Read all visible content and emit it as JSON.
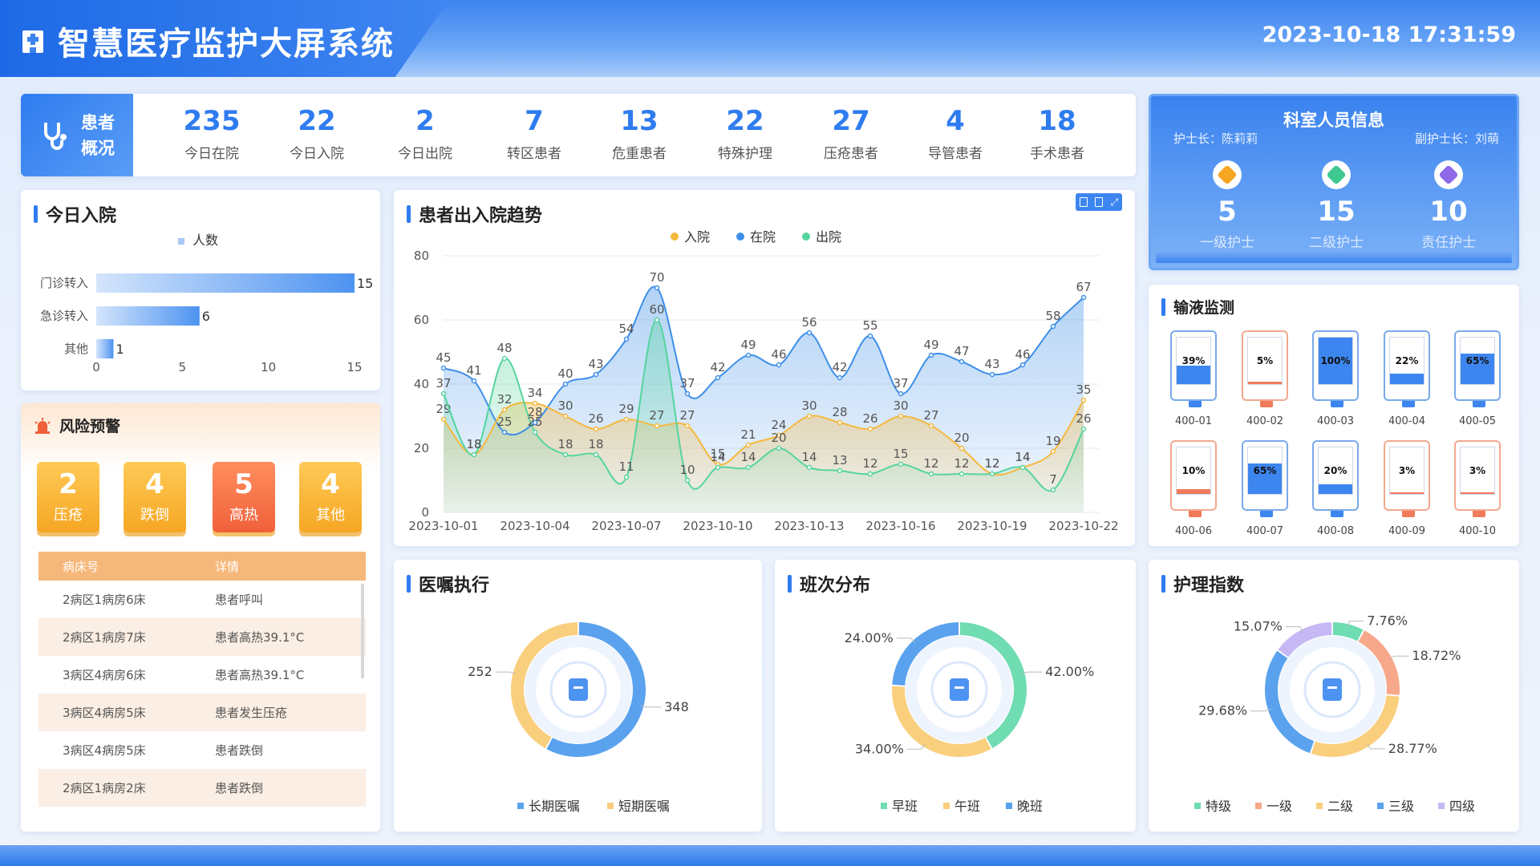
{
  "header": {
    "title": "智慧医疗监护大屏系统",
    "datetime": "2023-10-18 17:31:59"
  },
  "overview": {
    "label_line1": "患者",
    "label_line2": "概况",
    "stats": [
      {
        "value": "235",
        "label": "今日在院"
      },
      {
        "value": "22",
        "label": "今日入院"
      },
      {
        "value": "2",
        "label": "今日出院"
      },
      {
        "value": "7",
        "label": "转区患者"
      },
      {
        "value": "13",
        "label": "危重患者"
      },
      {
        "value": "22",
        "label": "特殊护理"
      },
      {
        "value": "27",
        "label": "压疮患者"
      },
      {
        "value": "4",
        "label": "导管患者"
      },
      {
        "value": "18",
        "label": "手术患者"
      }
    ]
  },
  "staff": {
    "title": "科室人员信息",
    "head_nurse": "护士长：陈莉莉",
    "deputy_head_nurse": "副护士长：刘萌",
    "items": [
      {
        "value": "5",
        "label": "一级护士",
        "color": "#f5a623"
      },
      {
        "value": "15",
        "label": "二级护士",
        "color": "#3ec88f"
      },
      {
        "value": "10",
        "label": "责任护士",
        "color": "#8e6ae8"
      }
    ]
  },
  "admission": {
    "title": "今日入院",
    "legend": "人数",
    "chart_data": {
      "type": "bar",
      "orientation": "horizontal",
      "categories": [
        "门诊转入",
        "急诊转入",
        "其他"
      ],
      "values": [
        15,
        6,
        1
      ],
      "xlim": [
        0,
        15
      ],
      "xticks": [
        "0",
        "5",
        "10",
        "15"
      ],
      "legend": "人数"
    }
  },
  "risk": {
    "title": "风险预警",
    "badges": [
      {
        "value": "2",
        "label": "压疮",
        "color": "#f5a623"
      },
      {
        "value": "4",
        "label": "跌倒",
        "color": "#f5a623"
      },
      {
        "value": "5",
        "label": "高热",
        "color": "#f0603a"
      },
      {
        "value": "4",
        "label": "其他",
        "color": "#f5a623"
      }
    ],
    "columns": [
      "病床号",
      "详情"
    ],
    "rows": [
      [
        "2病区1病房6床",
        "患者呼叫"
      ],
      [
        "2病区1病房7床",
        "患者高热39.1°C"
      ],
      [
        "3病区4病房6床",
        "患者高热39.1°C"
      ],
      [
        "3病区4病房5床",
        "患者发生压疮"
      ],
      [
        "3病区4病房5床",
        "患者跌倒"
      ],
      [
        "2病区1病房2床",
        "患者跌倒"
      ]
    ]
  },
  "trend": {
    "title": "患者出入院趋势",
    "chart_data": {
      "type": "line",
      "x": [
        "2023-10-01",
        "2023-10-02",
        "2023-10-03",
        "2023-10-04",
        "2023-10-05",
        "2023-10-06",
        "2023-10-07",
        "2023-10-08",
        "2023-10-09",
        "2023-10-10",
        "2023-10-11",
        "2023-10-12",
        "2023-10-13",
        "2023-10-14",
        "2023-10-15",
        "2023-10-16",
        "2023-10-17",
        "2023-10-18",
        "2023-10-19",
        "2023-10-20",
        "2023-10-21",
        "2023-10-22"
      ],
      "xticks": [
        "2023-10-01",
        "2023-10-04",
        "2023-10-07",
        "2023-10-10",
        "2023-10-13",
        "2023-10-16",
        "2023-10-19",
        "2023-10-22"
      ],
      "ylim": [
        0,
        80
      ],
      "yticks": [
        "0",
        "20",
        "40",
        "60",
        "80"
      ],
      "series": [
        {
          "name": "入院",
          "color": "#f5b83d",
          "values": [
            29,
            18,
            32,
            34,
            30,
            26,
            29,
            27,
            27,
            15,
            21,
            24,
            30,
            28,
            26,
            30,
            27,
            20,
            12,
            14,
            19,
            35
          ]
        },
        {
          "name": "在院",
          "color": "#3e8fe8",
          "values": [
            45,
            41,
            25,
            28,
            40,
            43,
            54,
            70,
            37,
            42,
            49,
            46,
            56,
            42,
            55,
            37,
            49,
            47,
            43,
            46,
            58,
            67
          ]
        },
        {
          "name": "出院",
          "color": "#56d49e",
          "values": [
            37,
            18,
            48,
            25,
            18,
            18,
            11,
            60,
            10,
            14,
            14,
            20,
            14,
            13,
            12,
            15,
            12,
            12,
            12,
            14,
            7,
            26
          ]
        }
      ]
    }
  },
  "infusion": {
    "title": "输液监测",
    "items": [
      {
        "id": "400-01",
        "pct": "39%",
        "level": 0.39,
        "color": "#3d86ef"
      },
      {
        "id": "400-02",
        "pct": "5%",
        "level": 0.05,
        "color": "#f07a5a"
      },
      {
        "id": "400-03",
        "pct": "100%",
        "level": 1.0,
        "color": "#3d86ef"
      },
      {
        "id": "400-04",
        "pct": "22%",
        "level": 0.22,
        "color": "#3d86ef"
      },
      {
        "id": "400-05",
        "pct": "65%",
        "level": 0.65,
        "color": "#3d86ef"
      },
      {
        "id": "400-06",
        "pct": "10%",
        "level": 0.1,
        "color": "#f07a5a"
      },
      {
        "id": "400-07",
        "pct": "65%",
        "level": 0.65,
        "color": "#3d86ef"
      },
      {
        "id": "400-08",
        "pct": "20%",
        "level": 0.2,
        "color": "#3d86ef"
      },
      {
        "id": "400-09",
        "pct": "3%",
        "level": 0.03,
        "color": "#f07a5a"
      },
      {
        "id": "400-10",
        "pct": "3%",
        "level": 0.03,
        "color": "#f07a5a"
      }
    ]
  },
  "orders": {
    "title": "医嘱执行",
    "chart_data": {
      "type": "pie",
      "labels": [
        "长期医嘱",
        "短期医嘱"
      ],
      "values": [
        348,
        252
      ],
      "value_labels": [
        "348",
        "252"
      ],
      "colors": [
        "#5aa2ee",
        "#f9cf7e"
      ]
    }
  },
  "shifts": {
    "title": "班次分布",
    "chart_data": {
      "type": "pie",
      "labels": [
        "早班",
        "午班",
        "晚班"
      ],
      "values": [
        42,
        34,
        24
      ],
      "value_labels": [
        "42.00%",
        "34.00%",
        "24.00%"
      ],
      "colors": [
        "#6fdcb1",
        "#f9cf7e",
        "#5aa2ee"
      ]
    }
  },
  "nursing": {
    "title": "护理指数",
    "chart_data": {
      "type": "pie",
      "labels": [
        "特级",
        "一级",
        "二级",
        "三级",
        "四级"
      ],
      "values": [
        7.76,
        18.72,
        28.77,
        29.68,
        15.07
      ],
      "value_labels": [
        "7.76%",
        "18.72%",
        "28.77%",
        "29.68%",
        "15.07%"
      ],
      "colors": [
        "#6fdcb1",
        "#f7a88a",
        "#f9cf7e",
        "#5aa2ee",
        "#c6b8f5"
      ]
    }
  }
}
